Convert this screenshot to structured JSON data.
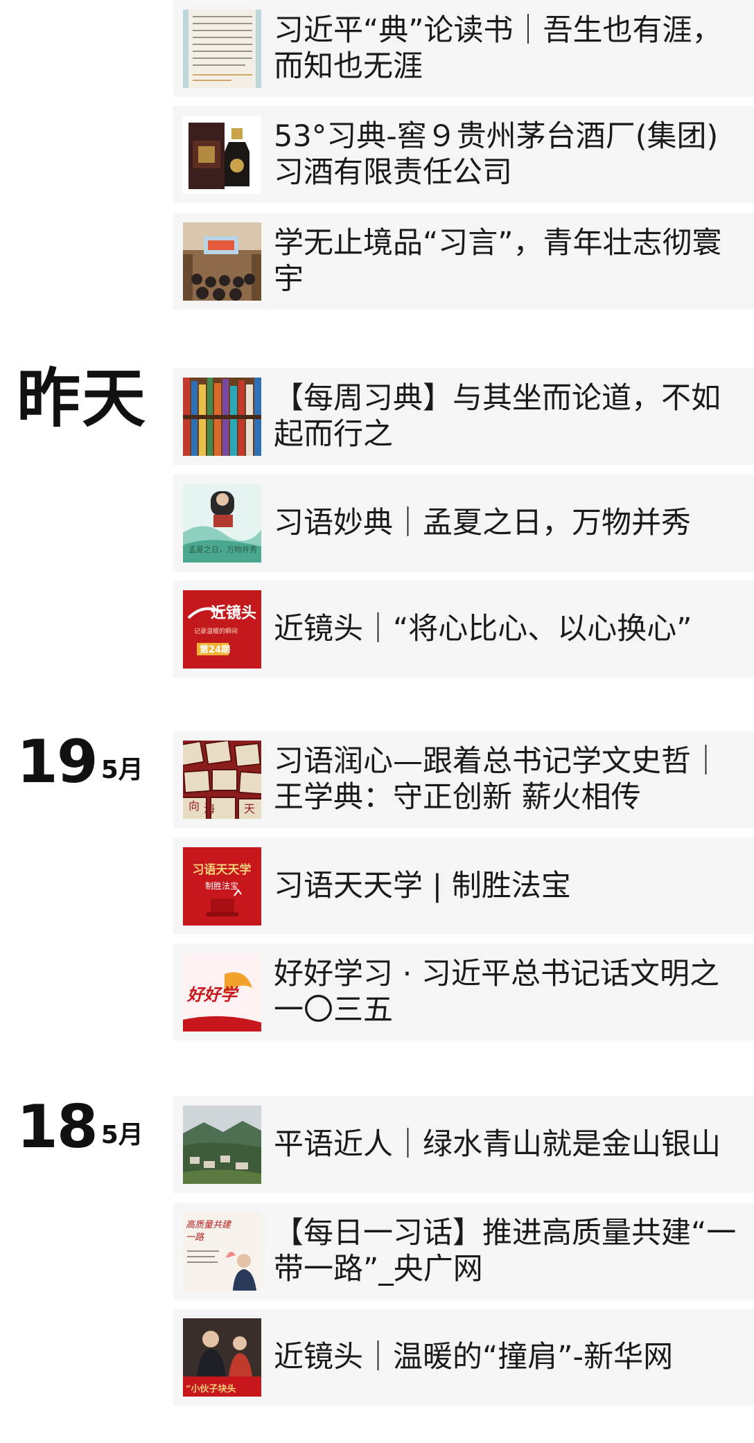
{
  "groups": [
    {
      "date_main": "",
      "date_sub": "",
      "items": [
        {
          "title": "习近平“典”论读书｜吾生也有涯，而知也无涯",
          "icon": "book-page-thumbnail"
        },
        {
          "title": "53°习典-窖９贵州茅台酒厂(集团)习酒有限责任公司",
          "icon": "liquor-bottle-thumbnail"
        },
        {
          "title": "学无止境品“习言”，青年壮志彻寰宇",
          "icon": "lecture-hall-thumbnail"
        }
      ]
    },
    {
      "date_main": "昨天",
      "date_sub": "",
      "items": [
        {
          "title": "【每周习典】与其坐而论道，不如起而行之",
          "icon": "bookshelf-thumbnail"
        },
        {
          "title": "习语妙典｜孟夏之日，万物并秀",
          "icon": "speech-landscape-thumbnail"
        },
        {
          "title": "近镜头｜“将心比心、以心换心”",
          "icon": "red-poster-thumbnail"
        }
      ]
    },
    {
      "date_main": "19",
      "date_sub": "5月",
      "items": [
        {
          "title": "习语润心—跟着总书记学文史哲｜王学典：守正创新 薪火相传",
          "icon": "calligraphy-blocks-thumbnail"
        },
        {
          "title": "习语天天学 | 制胜法宝",
          "icon": "red-banner-thumbnail"
        },
        {
          "title": "好好学习 · 习近平总书记话文明之一〇三五",
          "icon": "study-logo-thumbnail"
        }
      ]
    },
    {
      "date_main": "18",
      "date_sub": "5月",
      "items": [
        {
          "title": "平语近人｜绿水青山就是金山银山",
          "icon": "mountain-village-thumbnail"
        },
        {
          "title": "【每日一习话】推进高质量共建“一带一路”_央广网",
          "icon": "calligraphy-thumbnail"
        },
        {
          "title": "近镜头｜温暖的“撞肩”-新华网",
          "icon": "photo-poster-thumbnail"
        }
      ]
    }
  ],
  "thumb_text": {
    "jingtou": "近镜头",
    "jingtou_sub": "记录温暖的瞬间",
    "issue": "第24期",
    "xiyu": "习语天天学",
    "zhisheng": "制胜法宝",
    "haohao": "好好学",
    "mengxia": "孟夏之日，万物并秀",
    "xiaohuo": "“小伙子块头",
    "yidai": "高质量共建\n一路"
  },
  "colors": {
    "item_bg": "#f5f5f5",
    "text": "#1a1a1a",
    "accent_red": "#c8161d"
  }
}
